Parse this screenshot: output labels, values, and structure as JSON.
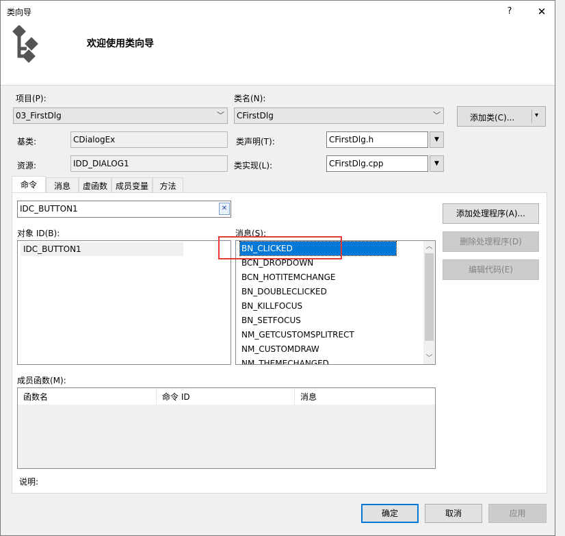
{
  "window": {
    "title": "类向导",
    "help": "?",
    "close": "✕"
  },
  "banner": {
    "heading": "欢迎使用类向导",
    "logo_icon": "class-wizard-icon"
  },
  "project": {
    "label": "项目(P):",
    "value": "03_FirstDlg"
  },
  "classname": {
    "label": "类名(N):",
    "value": "CFirstDlg"
  },
  "add_class": {
    "label": "添加类(C)...",
    "dropdown": "▾"
  },
  "base": {
    "label": "基类:",
    "value": "CDialogEx"
  },
  "declare": {
    "label": "类声明(T):",
    "value": "CFirstDlg.h"
  },
  "resource": {
    "label": "资源:",
    "value": "IDD_DIALOG1"
  },
  "implement": {
    "label": "类实现(L):",
    "value": "CFirstDlg.cpp"
  },
  "tabs": [
    "命令",
    "消息",
    "虚函数",
    "成员变量",
    "方法"
  ],
  "search": {
    "value": "IDC_BUTTON1",
    "clear": "✕"
  },
  "object_ids": {
    "label": "对象 ID(B):",
    "items": [
      "IDC_BUTTON1"
    ]
  },
  "messages": {
    "label": "消息(S):",
    "items": [
      "BN_CLICKED",
      "BCN_DROPDOWN",
      "BCN_HOTITEMCHANGE",
      "BN_DOUBLECLICKED",
      "BN_KILLFOCUS",
      "BN_SETFOCUS",
      "NM_GETCUSTOMSPLITRECT",
      "NM_CUSTOMDRAW",
      "NM_THEMECHANGED"
    ],
    "selected": "BN_CLICKED"
  },
  "actions": {
    "add_handler": "添加处理程序(A)...",
    "delete_handler": "删除处理程序(D)",
    "edit_code": "编辑代码(E)"
  },
  "members": {
    "label": "成员函数(M):",
    "columns": [
      "函数名",
      "命令 ID",
      "消息"
    ]
  },
  "description": {
    "label": "说明:"
  },
  "footer": {
    "ok": "确定",
    "cancel": "取消",
    "apply": "应用"
  },
  "colors": {
    "selection": "#0078d7",
    "highlight_box": "#e53935",
    "default_button_border": "#0078d7"
  }
}
